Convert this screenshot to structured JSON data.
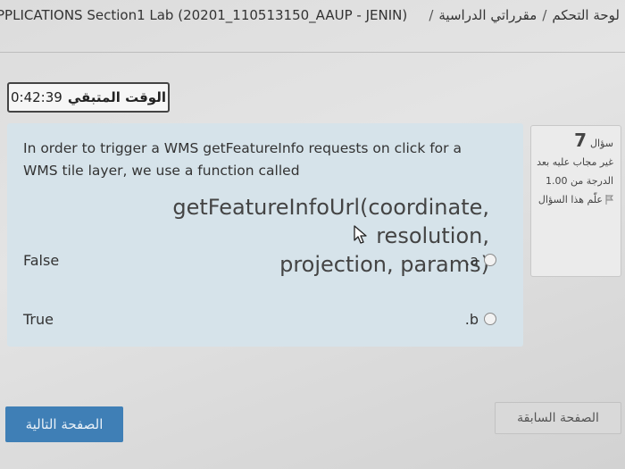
{
  "breadcrumb": {
    "course": "PPLICATIONS Section1 Lab (20201_110513150_AAUP - JENIN)",
    "my_courses": "مقرراتي الدراسية",
    "dashboard": "لوحة التحكم",
    "separator": "/"
  },
  "timer": {
    "label": "الوقت المتبقي",
    "value": "0:42:39"
  },
  "question_info": {
    "label": "سؤال",
    "number": "7",
    "status": "غير مجاب عليه بعد",
    "grade": "الدرجة من 1.00",
    "flag": "علّم هذا السؤال"
  },
  "question": {
    "text": "In order to trigger a WMS getFeatureInfo requests on click for a WMS tile layer, we use a function called",
    "code_line1": "getFeatureInfoUrl(coordinate, resolution,",
    "code_line2": "projection, params)"
  },
  "answers": [
    {
      "text": "False",
      "letter": ".a",
      "selected": false
    },
    {
      "text": "True",
      "letter": ".b",
      "selected": false
    }
  ],
  "nav": {
    "next": "الصفحة التالية",
    "previous": "الصفحة السابقة"
  },
  "colors": {
    "question_bg": "#d6e3ea",
    "next_button": "#3f7fb6",
    "info_bg": "#ebebeb"
  }
}
